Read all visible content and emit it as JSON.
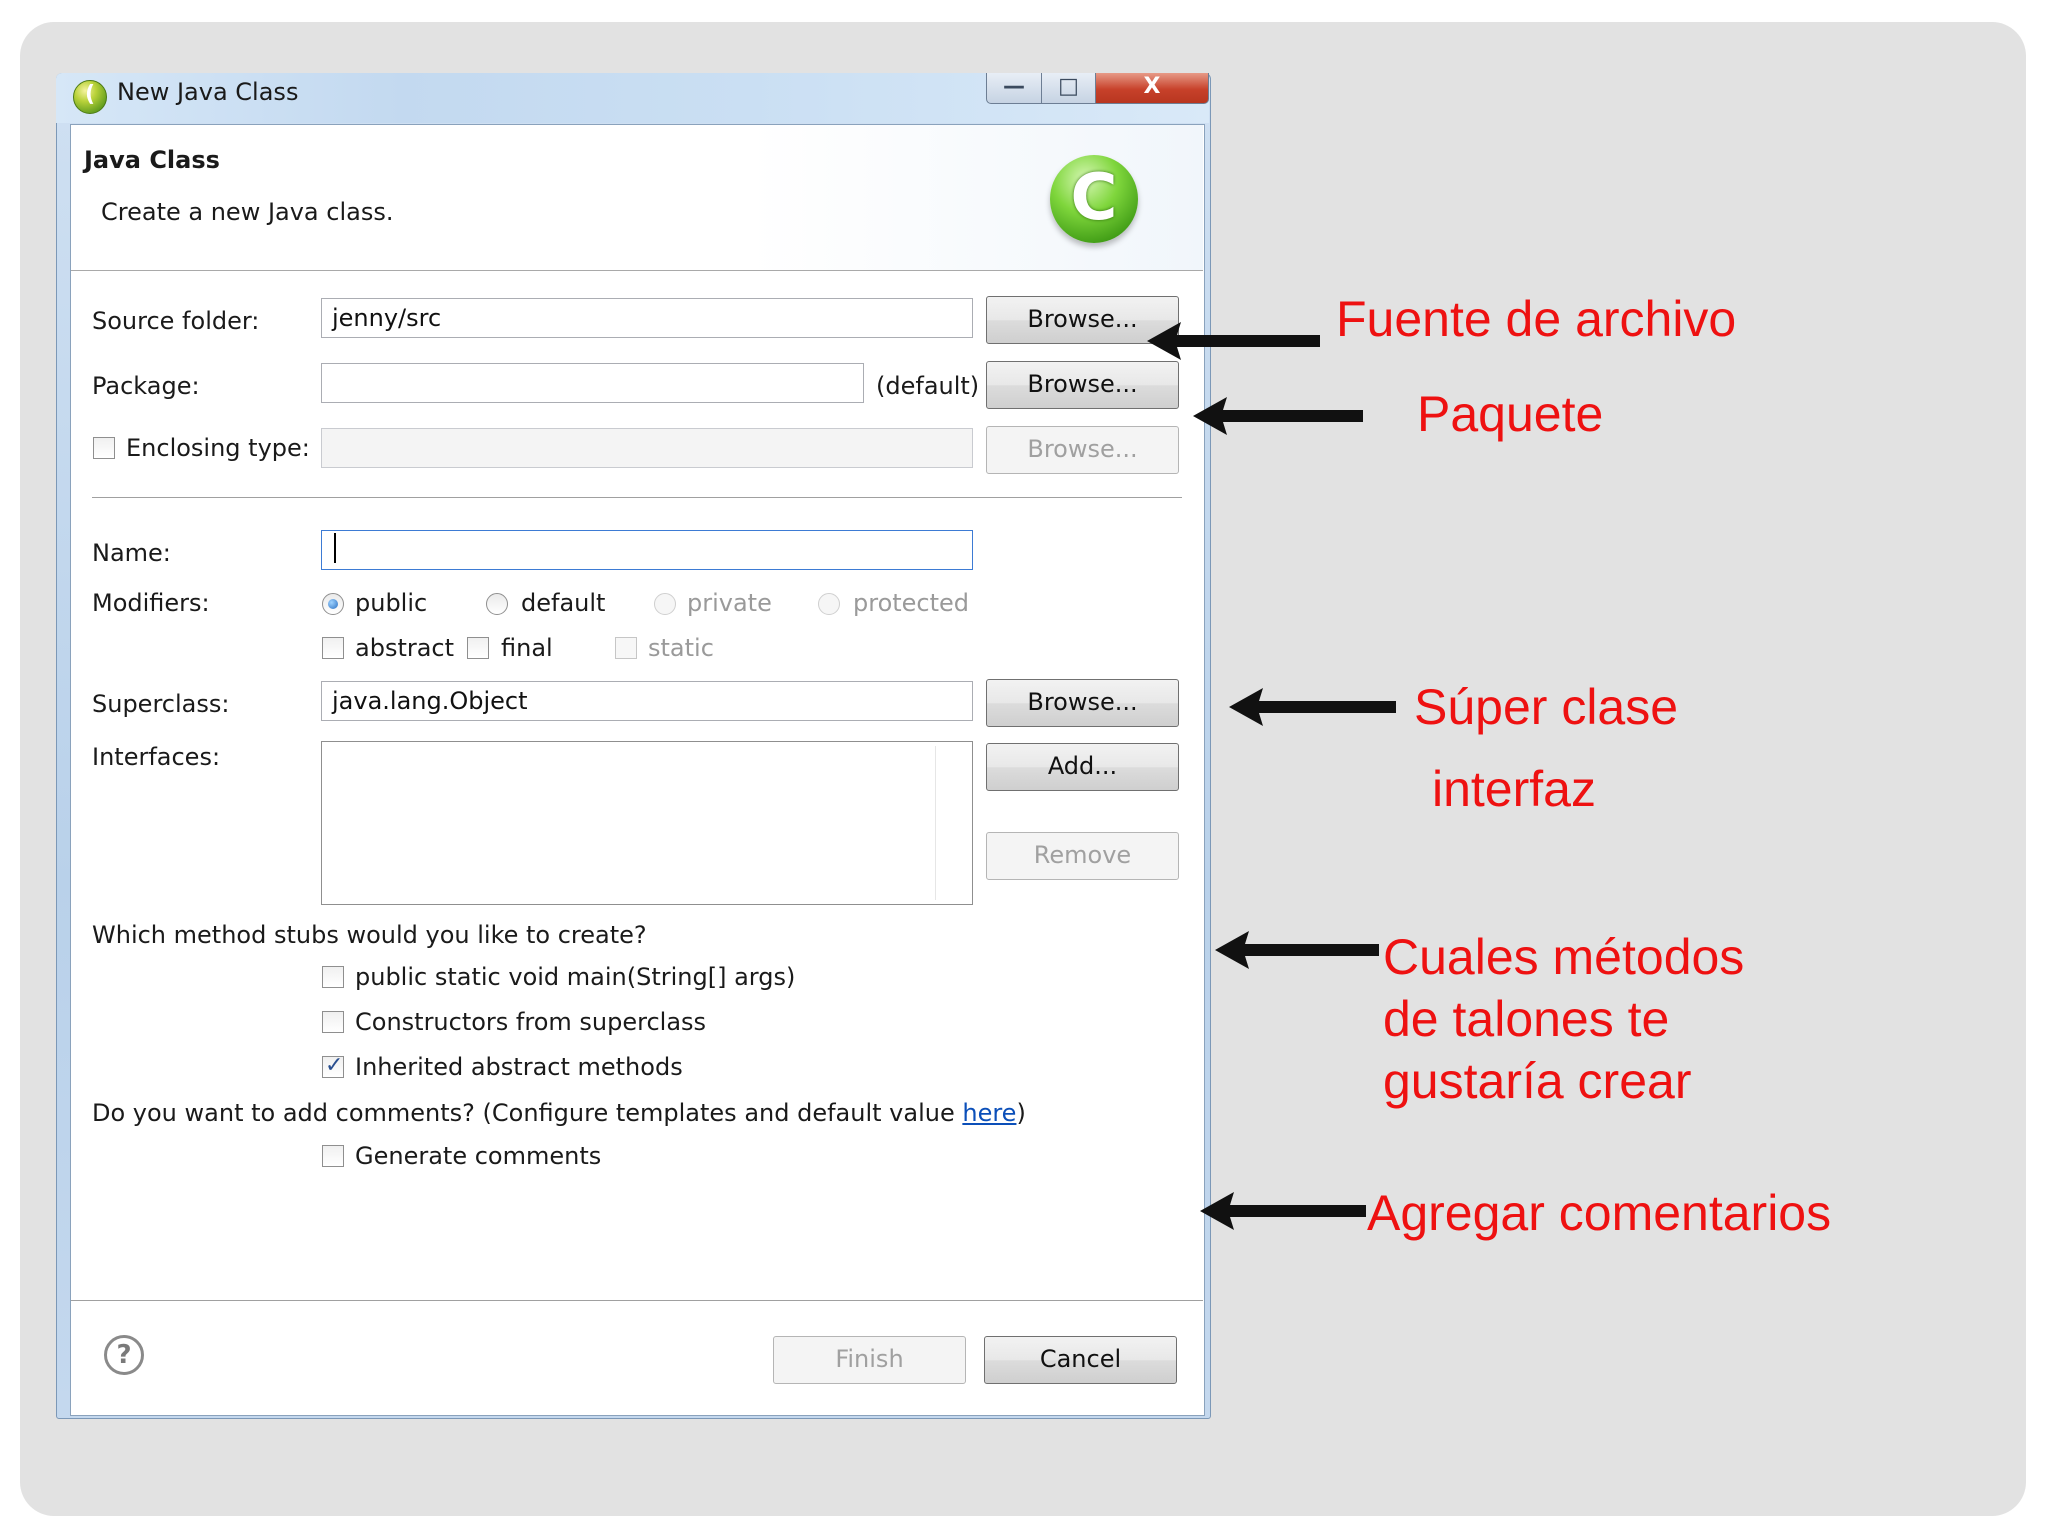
{
  "window": {
    "title": "New Java Class",
    "minimize_glyph": "—",
    "maximize_glyph": "□",
    "close_glyph": "X"
  },
  "banner": {
    "title": "Java Class",
    "description": "Create a new Java class.",
    "logo_letter": "C"
  },
  "source_folder": {
    "label": "Source folder:",
    "value": "jenny/src",
    "browse": "Browse..."
  },
  "package": {
    "label": "Package:",
    "value": "",
    "hint": "(default)",
    "browse": "Browse..."
  },
  "enclosing_type": {
    "label": "Enclosing type:",
    "checked": false,
    "value": "",
    "browse": "Browse..."
  },
  "name": {
    "label": "Name:",
    "value": ""
  },
  "modifiers": {
    "label": "Modifiers:",
    "access": [
      "public",
      "default",
      "private",
      "protected"
    ],
    "selected_access": "public",
    "flags": [
      "abstract",
      "final",
      "static"
    ]
  },
  "superclass": {
    "label": "Superclass:",
    "value": "java.lang.Object",
    "browse": "Browse..."
  },
  "interfaces": {
    "label": "Interfaces:",
    "add": "Add...",
    "remove": "Remove"
  },
  "stubs": {
    "question": "Which method stubs would you like to create?",
    "options": [
      {
        "label": "public static void main(String[] args)",
        "checked": false
      },
      {
        "label": "Constructors from superclass",
        "checked": false
      },
      {
        "label": "Inherited abstract methods",
        "checked": true
      }
    ]
  },
  "comments": {
    "question_prefix": "Do you want to add comments? (Configure templates and default value ",
    "link": "here",
    "question_suffix": ")",
    "option": "Generate comments",
    "checked": false
  },
  "footer": {
    "help_glyph": "?",
    "finish": "Finish",
    "cancel": "Cancel"
  },
  "annotations": {
    "source_folder": "Fuente de archivo",
    "package": "Paquete",
    "superclass": "Súper clase",
    "interfaces": "interfaz",
    "stubs_line1": "Cuales métodos",
    "stubs_line2": "de talones te",
    "stubs_line3": "gustaría crear",
    "comments": "Agregar comentarios",
    "color": "#ee1111"
  }
}
